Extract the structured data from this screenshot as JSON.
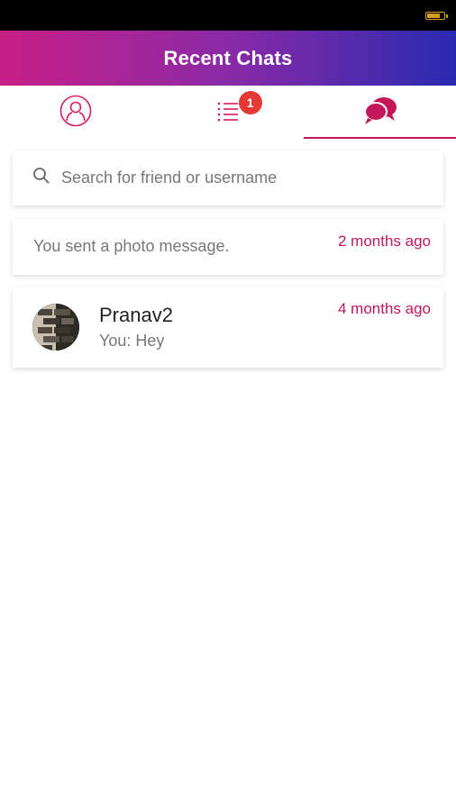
{
  "status_bar": {
    "battery_level": 0.8,
    "battery_color": "#d69a1f"
  },
  "header": {
    "title": "Recent Chats"
  },
  "tabs": [
    {
      "name": "profile",
      "icon": "user-icon",
      "active": false
    },
    {
      "name": "list",
      "icon": "list-icon",
      "badge": "1",
      "active": false
    },
    {
      "name": "chats",
      "icon": "chat-bubbles-icon",
      "active": true
    }
  ],
  "search": {
    "placeholder": "Search for friend or username",
    "value": ""
  },
  "chats": [
    {
      "name": "",
      "preview": "You sent a photo message.",
      "time": "2 months ago"
    },
    {
      "name": "Pranav2",
      "preview": "You: Hey",
      "time": "4 months ago"
    }
  ],
  "colors": {
    "accent": "#c2185b",
    "badge": "#e53935",
    "header_start": "#c81f86",
    "header_end": "#2a2ab0"
  }
}
